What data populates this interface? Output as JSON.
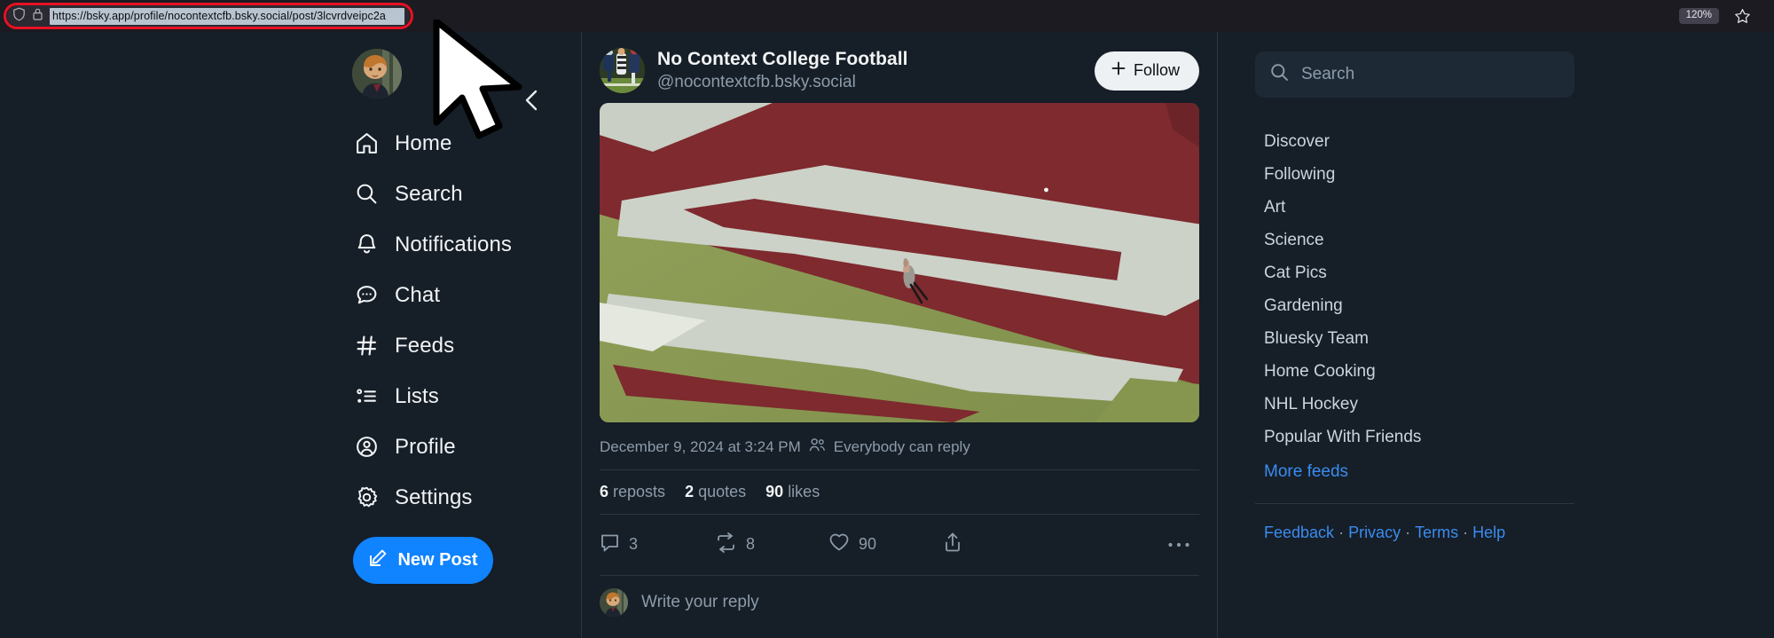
{
  "browser": {
    "url": "https://bsky.app/profile/nocontextcfb.bsky.social/post/3lcvrdveipc2a",
    "zoom_level": "120%",
    "shield_icon": "shield-icon",
    "lock_icon": "lock-icon",
    "star_icon": "star-icon",
    "url_highlight_color": "#e81123"
  },
  "theme": {
    "background": "#161e27",
    "panel": "#1e2936",
    "border": "#2a3643",
    "text_primary": "#f1f3f5",
    "text_muted": "#8d9cab",
    "accent": "#1083fe",
    "link": "#3a8cf0"
  },
  "left_sidebar": {
    "avatar_name": "user-avatar",
    "back_label": "back-chevron-icon",
    "items": [
      {
        "label": "Home",
        "icon": "home-icon"
      },
      {
        "label": "Search",
        "icon": "search-icon"
      },
      {
        "label": "Notifications",
        "icon": "bell-icon"
      },
      {
        "label": "Chat",
        "icon": "chat-bubble-icon"
      },
      {
        "label": "Feeds",
        "icon": "hash-icon"
      },
      {
        "label": "Lists",
        "icon": "list-icon"
      },
      {
        "label": "Profile",
        "icon": "person-circle-icon"
      },
      {
        "label": "Settings",
        "icon": "gear-icon"
      }
    ],
    "new_post_label": "New Post",
    "new_post_icon": "compose-icon"
  },
  "post": {
    "author_display_name": "No Context College Football",
    "author_handle": "@nocontextcfb.bsky.social",
    "follow_label": "Follow",
    "follow_icon": "plus-icon",
    "timestamp": "December 9, 2024 at 3:24 PM",
    "reply_setting": "Everybody can reply",
    "reply_setting_icon": "people-icon",
    "stats": [
      {
        "count": "6",
        "label": "reposts"
      },
      {
        "count": "2",
        "label": "quotes"
      },
      {
        "count": "90",
        "label": "likes"
      }
    ],
    "actions": [
      {
        "name": "reply",
        "icon": "reply-bubble-icon",
        "count": "3"
      },
      {
        "name": "repost",
        "icon": "repost-arrows-icon",
        "count": "8"
      },
      {
        "name": "like",
        "icon": "heart-icon",
        "count": "90"
      },
      {
        "name": "share",
        "icon": "share-upload-icon",
        "count": ""
      },
      {
        "name": "more",
        "icon": "ellipsis-icon",
        "count": ""
      }
    ],
    "media_alt": "Aerial view of a football field showing a maroon and white end zone logo with a small animal standing on it"
  },
  "composer": {
    "placeholder": "Write your reply",
    "avatar_name": "composer-avatar"
  },
  "right_sidebar": {
    "search_placeholder": "Search",
    "search_icon": "search-icon",
    "feeds": [
      "Discover",
      "Following",
      "Art",
      "Science",
      "Cat Pics",
      "Gardening",
      "Bluesky Team",
      "Home Cooking",
      "NHL Hockey",
      "Popular With Friends"
    ],
    "more_feeds_label": "More feeds",
    "footer_links": [
      "Feedback",
      "Privacy",
      "Terms",
      "Help"
    ],
    "footer_separator": "·"
  }
}
